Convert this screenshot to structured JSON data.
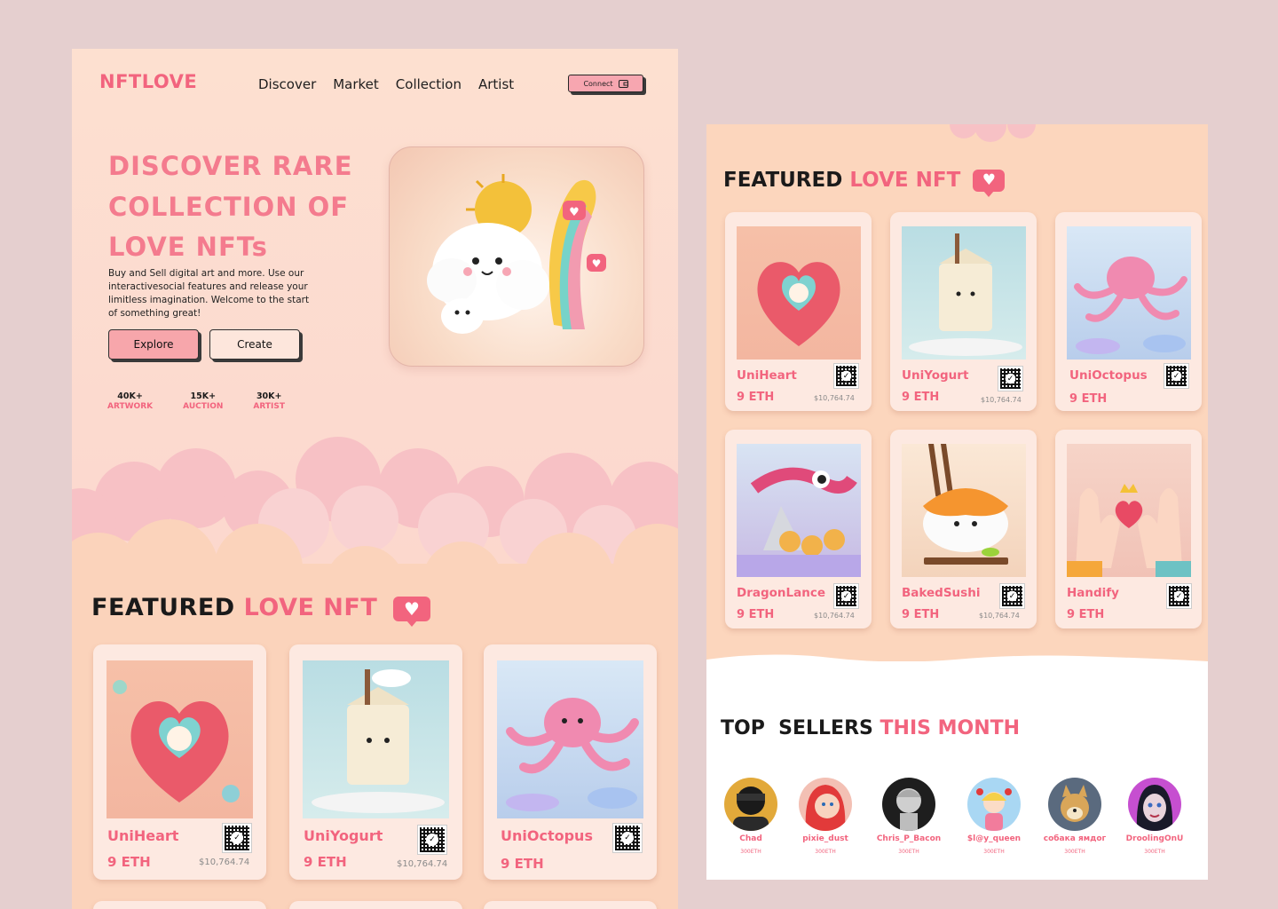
{
  "brand": {
    "logo_part1": "NFT",
    "logo_part2": "LOVE"
  },
  "nav": [
    "Discover",
    "Market",
    "Collection",
    "Artist"
  ],
  "connect_label": "Connect",
  "hero": {
    "title": "DISCOVER RARE COLLECTION OF LOVE NFTs",
    "subtitle": "Buy and Sell digital art and more. Use our interactivesocial features and release your limitless imagination. Welcome to the start of something great!",
    "explore_label": "Explore",
    "create_label": "Create",
    "stats": [
      {
        "value": "40K+",
        "label": "ARTWORK"
      },
      {
        "value": "15K+",
        "label": "AUCTION"
      },
      {
        "value": "30K+",
        "label": "ARTIST"
      }
    ]
  },
  "featured": {
    "title_dark": "FEATURED",
    "title_pink": "LOVE NFT",
    "heart": "♥"
  },
  "left_cards": [
    {
      "name": "UniHeart",
      "eth": "9 ETH",
      "usd": "$10,764.74"
    },
    {
      "name": "UniYogurt",
      "eth": "9 ETH",
      "usd": "$10,764.74"
    },
    {
      "name": "UniOctopus",
      "eth": "9 ETH",
      "usd": ""
    }
  ],
  "right_cards": [
    {
      "name": "UniHeart",
      "eth": "9 ETH",
      "usd": "$10,764.74"
    },
    {
      "name": "UniYogurt",
      "eth": "9 ETH",
      "usd": "$10,764.74"
    },
    {
      "name": "UniOctopus",
      "eth": "9 ETH",
      "usd": ""
    },
    {
      "name": "DragonLance",
      "eth": "9 ETH",
      "usd": "$10,764.74"
    },
    {
      "name": "BakedSushi",
      "eth": "9 ETH",
      "usd": "$10,764.74"
    },
    {
      "name": "Handify",
      "eth": "9 ETH",
      "usd": ""
    }
  ],
  "sellers": {
    "title_dark": "TOP  SELLERS",
    "title_pink": "THIS MONTH",
    "items": [
      {
        "name": "Chad",
        "eth": "300ETH"
      },
      {
        "name": "pixie_dust",
        "eth": "300ETH"
      },
      {
        "name": "Chris_P_Bacon",
        "eth": "300ETH"
      },
      {
        "name": "$l@y_queen",
        "eth": "300ETH"
      },
      {
        "name": "собака ямдог",
        "eth": "300ETH"
      },
      {
        "name": "DroolingOnU",
        "eth": "300ETH"
      }
    ]
  },
  "colors": {
    "accent": "#f2647e",
    "peach": "#fbd3bb",
    "page_bg": "#e5cfcf"
  }
}
